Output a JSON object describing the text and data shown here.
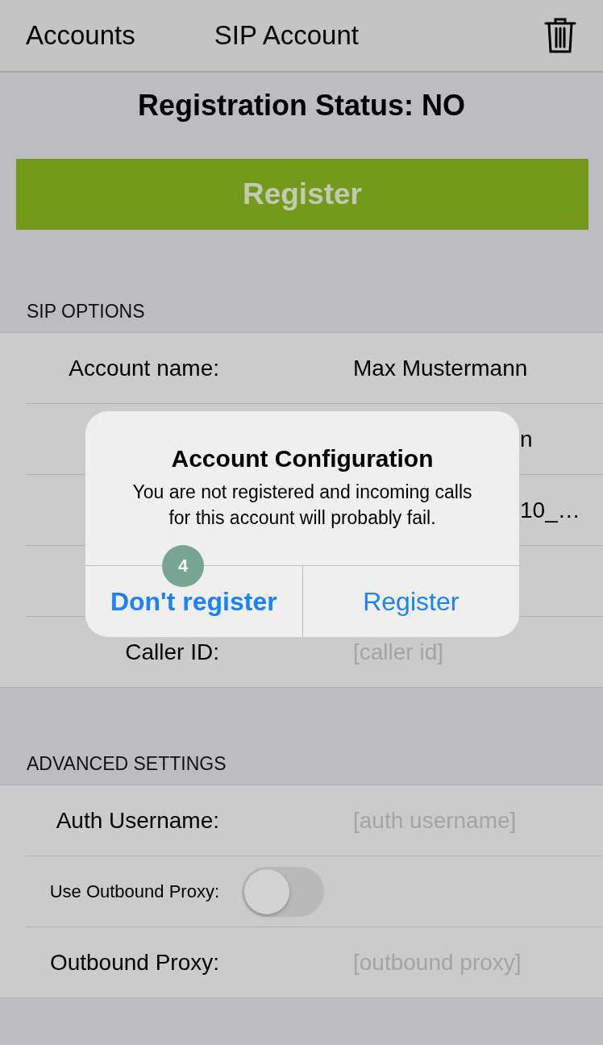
{
  "nav": {
    "back": "Accounts",
    "title": "SIP Account"
  },
  "registration_status": "Registration Status: NO",
  "register_button": "Register",
  "sections": [
    {
      "header": "SIP OPTIONS",
      "rows": [
        {
          "kind": "field",
          "label": "Account name:",
          "value": "Max Mustermann"
        },
        {
          "kind": "covered",
          "value": "n"
        },
        {
          "kind": "covered",
          "value": "10_…"
        },
        {
          "kind": "covered"
        },
        {
          "kind": "field",
          "label": "Caller ID:",
          "placeholder": "[caller id]"
        }
      ]
    },
    {
      "header": "ADVANCED SETTINGS",
      "rows": [
        {
          "kind": "field",
          "label": "Auth Username:",
          "placeholder": "[auth username]"
        },
        {
          "kind": "toggle",
          "label": "Use Outbound Proxy:",
          "on": false
        },
        {
          "kind": "field",
          "label": "Outbound Proxy:",
          "placeholder": "[outbound proxy]"
        }
      ]
    }
  ],
  "alert": {
    "title": "Account Configuration",
    "message": "You are not registered and incoming calls for this account will probably fail.",
    "buttons": [
      {
        "label": "Don't register",
        "bold": true
      },
      {
        "label": "Register",
        "bold": false
      }
    ],
    "step_badge": "4"
  }
}
